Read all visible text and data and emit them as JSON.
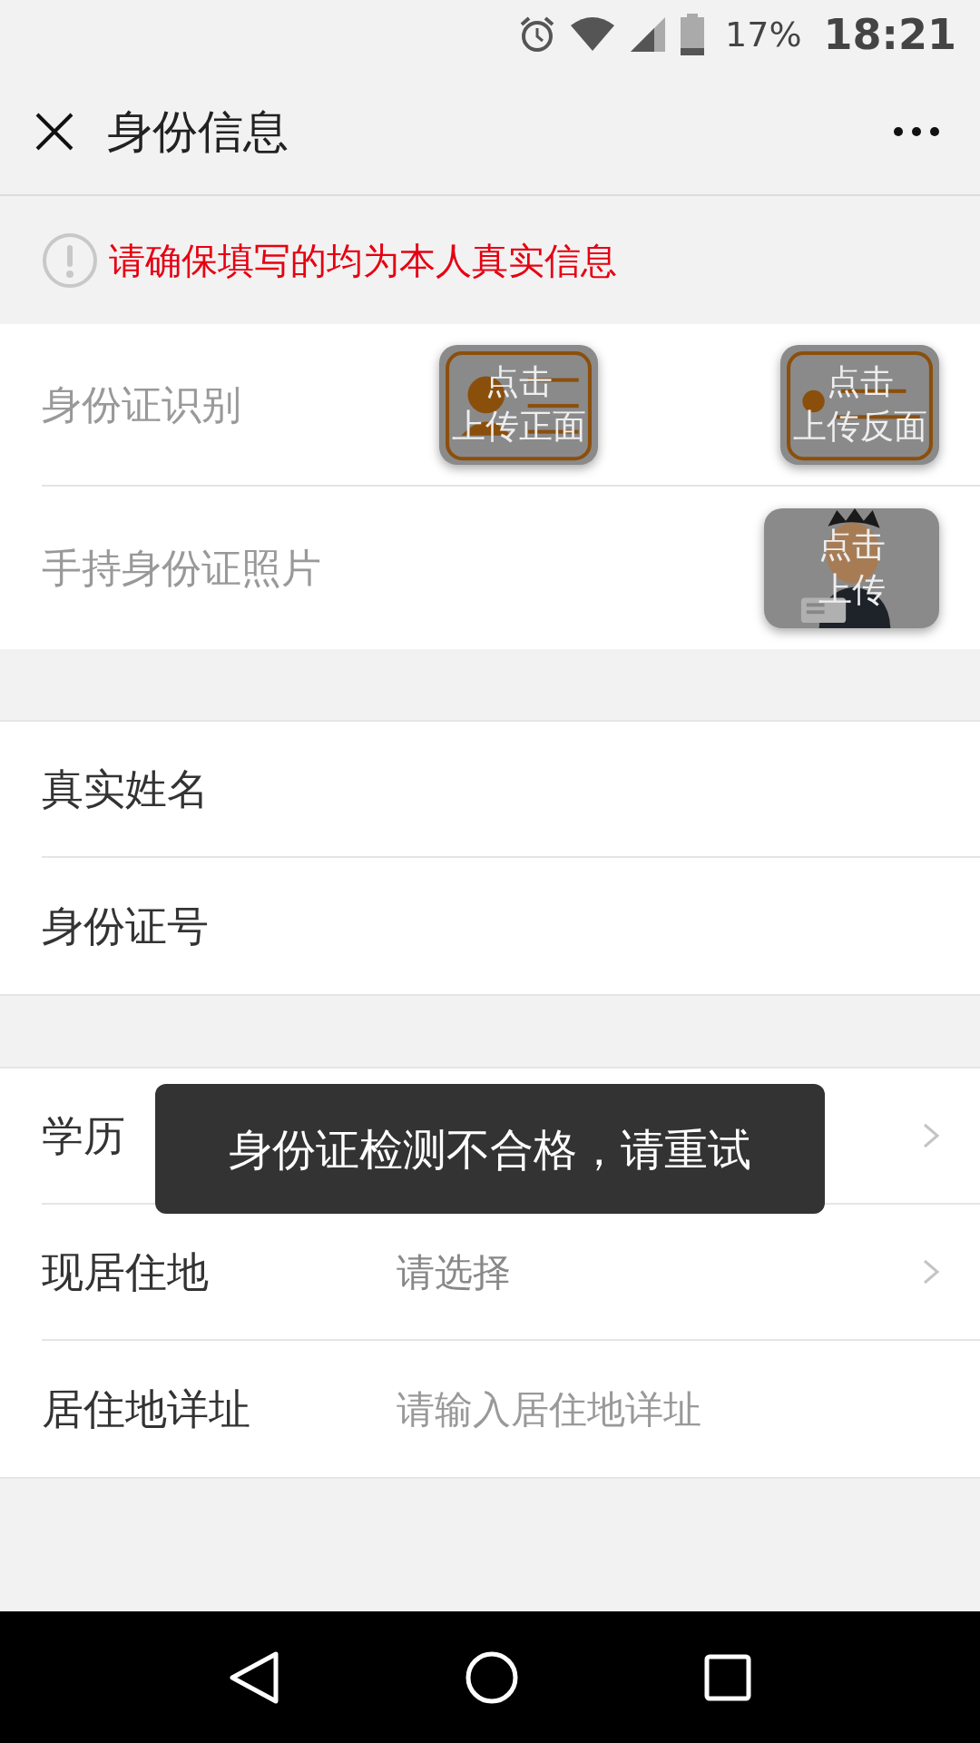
{
  "status_bar": {
    "battery": "17%",
    "time": "18:21"
  },
  "header": {
    "title": "身份信息"
  },
  "notice": {
    "text": "请确保填写的均为本人真实信息"
  },
  "upload_rows": [
    {
      "label": "身份证识别",
      "buttons": [
        {
          "kind": "card_front",
          "lines": [
            "点击",
            "上传正面"
          ]
        },
        {
          "kind": "card_back",
          "lines": [
            "点击",
            "上传反面"
          ]
        }
      ]
    },
    {
      "label": "手持身份证照片",
      "buttons": [
        {
          "kind": "handheld",
          "lines": [
            "点击",
            "上传"
          ]
        }
      ]
    }
  ],
  "sections": [
    [
      {
        "kind": "input",
        "label": "真实姓名"
      },
      {
        "kind": "input",
        "label": "身份证号"
      }
    ],
    [
      {
        "kind": "select",
        "label": "学历"
      },
      {
        "kind": "select",
        "label": "现居住地",
        "placeholder": "请选择"
      },
      {
        "kind": "input",
        "label": "居住地详址",
        "placeholder": "请输入居住地详址"
      }
    ]
  ],
  "toast": {
    "text": "身份证检测不合格，请重试"
  }
}
